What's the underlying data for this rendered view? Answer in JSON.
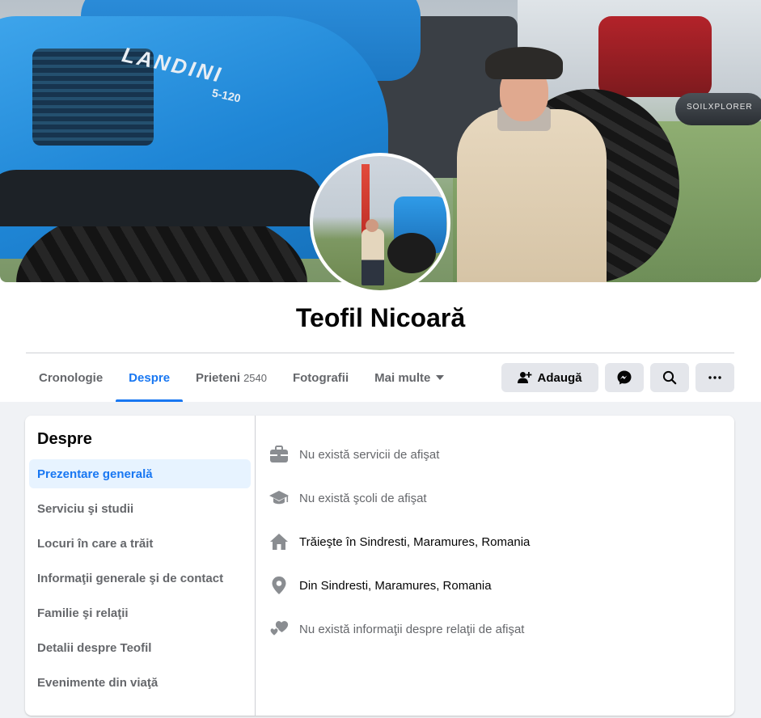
{
  "profile": {
    "name": "Teofil Nicoară",
    "cover_text": {
      "brand": "LANDINI",
      "model": "5-120",
      "banner": "SOILXPLORER"
    }
  },
  "tabs": [
    {
      "label": "Cronologie"
    },
    {
      "label": "Despre",
      "active": true
    },
    {
      "label": "Prieteni",
      "count": "2540"
    },
    {
      "label": "Fotografii"
    },
    {
      "label": "Mai multe"
    }
  ],
  "actions": {
    "add_friend": "Adaugă",
    "messenger_icon": "messenger-icon",
    "search_icon": "search-icon",
    "more_icon": "more-icon"
  },
  "about": {
    "title": "Despre",
    "nav": [
      {
        "label": "Prezentare generală",
        "active": true
      },
      {
        "label": "Serviciu şi studii"
      },
      {
        "label": "Locuri în care a trăit"
      },
      {
        "label": "Informaţii generale şi de contact"
      },
      {
        "label": "Familie şi relaţii"
      },
      {
        "label": "Detalii despre Teofil"
      },
      {
        "label": "Evenimente din viaţă"
      }
    ],
    "items": [
      {
        "icon": "briefcase-icon",
        "text": "Nu există servicii de afişat"
      },
      {
        "icon": "graduation-cap-icon",
        "text": "Nu există şcoli de afişat"
      },
      {
        "icon": "home-icon",
        "text": "Trăieşte în Sindresti, Maramures, Romania"
      },
      {
        "icon": "location-pin-icon",
        "text": "Din Sindresti, Maramures, Romania"
      },
      {
        "icon": "heart-icon",
        "text": "Nu există informaţii despre relaţii de afişat"
      }
    ]
  },
  "colors": {
    "accent": "#1877f2",
    "muted": "#65676b",
    "button_bg": "#e4e6eb",
    "page_bg": "#f0f2f5"
  }
}
